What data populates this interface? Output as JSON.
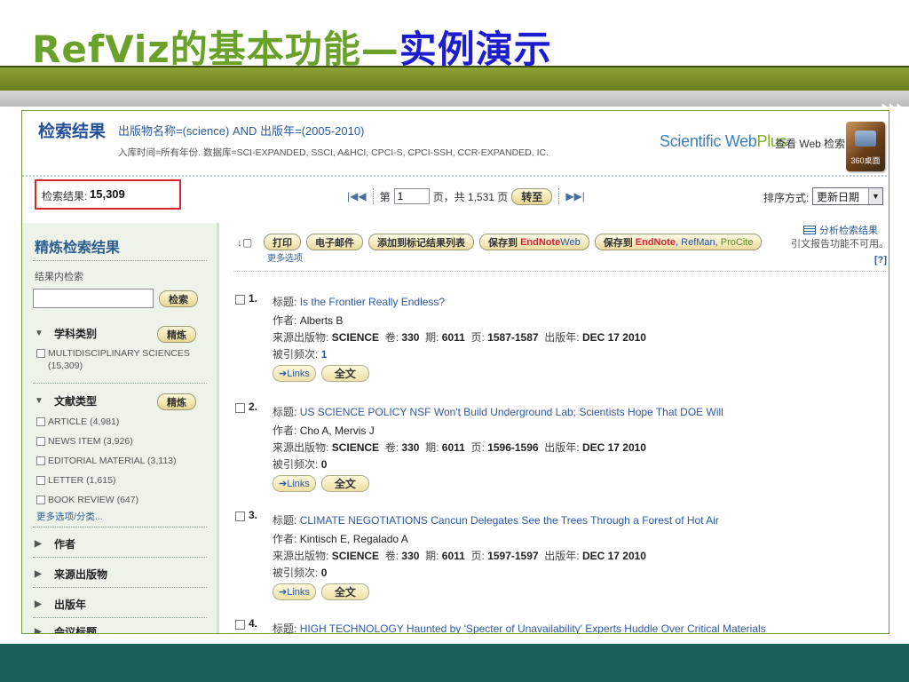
{
  "slide": {
    "title_green": "RefViz的基本功能",
    "title_sep": "—",
    "title_blue": "实例演示"
  },
  "colors": {
    "title_green": "#6aa12a",
    "title_blue": "#1d1dd0",
    "band_olive": "#7a9127",
    "band_teal": "#1a5f58",
    "highlight_red": "#d8262d"
  },
  "wos": {
    "title": "检索结果",
    "query_line1": "出版物名称=(science) AND 出版年=(2005-2010)",
    "query_line2": "入库时间=所有年份. 数据库=SCI-EXPANDED, SSCI, A&HCI, CPCI-S, CPCI-SSH, CCR-EXPANDED, IC.",
    "swp_logo_a": "Scientific Web",
    "swp_logo_b": "Plus",
    "swp_link": "查看 Web 检索",
    "search360_label": "360桌面",
    "count_label": "检索结果:",
    "count_value": "15,309",
    "pager": {
      "first": "|◀◀",
      "page_label": "第",
      "page_value": "1",
      "page_total": "页，共 1,531 页",
      "go": "转至",
      "next": "▶▶|"
    },
    "sort_label": "排序方式:",
    "sort_value": "更新日期"
  },
  "sidebar": {
    "title": "精炼检索结果",
    "sub_label": "结果内检索",
    "search_btn": "检索",
    "refine_btn": "精炼",
    "facets": [
      {
        "name": "学科类别",
        "items": [
          "MULTIDISCIPLINARY SCIENCES (15,309)"
        ]
      },
      {
        "name": "文献类型",
        "items": [
          "ARTICLE (4,981)",
          "NEWS ITEM (3,926)",
          "EDITORIAL MATERIAL (3,113)",
          "LETTER (1,615)",
          "BOOK REVIEW (647)"
        ]
      }
    ],
    "more_link": "更多选项/分类...",
    "collapsed": [
      "作者",
      "来源出版物",
      "出版年",
      "会议标题"
    ]
  },
  "toolbar": {
    "print": "打印",
    "email": "电子邮件",
    "add_marked": "添加到标记结果列表",
    "save_enweb_a": "保存到",
    "save_enweb_b": "EndNote",
    "save_enweb_c": "Web",
    "save_en_a": "保存到",
    "save_en_b": "EndNote",
    "save_en_c": ", RefMan,",
    "save_en_d": "ProCite",
    "more_options": "更多选项",
    "analyze": "分析检索结果",
    "cite_note": "引文报告功能不可用。",
    "help": "[?]"
  },
  "records": [
    {
      "num": "1.",
      "title": "Is the Frontier Really Endless?",
      "authors": "Alberts B",
      "journal": "SCIENCE",
      "volume": "330",
      "issue": "6011",
      "pages": "1587-1587",
      "date": "DEC 17 2010",
      "cited": "1"
    },
    {
      "num": "2.",
      "title": "US SCIENCE POLICY NSF Won't Build Underground Lab; Scientists Hope That DOE Will",
      "authors": "Cho A, Mervis J",
      "journal": "SCIENCE",
      "volume": "330",
      "issue": "6011",
      "pages": "1596-1596",
      "date": "DEC 17 2010",
      "cited": "0"
    },
    {
      "num": "3.",
      "title": "CLIMATE NEGOTIATIONS Cancun Delegates See the Trees Through a Forest of Hot Air",
      "authors": "Kintisch E, Regalado A",
      "journal": "SCIENCE",
      "volume": "330",
      "issue": "6011",
      "pages": "1597-1597",
      "date": "DEC 17 2010",
      "cited": "0"
    },
    {
      "num": "4.",
      "title": "HIGH TECHNOLOGY Haunted by 'Specter of Unavailability' Experts Huddle Over Critical Materials"
    }
  ],
  "rec_labels": {
    "title": "标题:",
    "author": "作者:",
    "source": "来源出版物:",
    "volume": "卷:",
    "issue": "期:",
    "pages": "页:",
    "date": "出版年:",
    "cited": "被引频次:",
    "links": "Links",
    "full": "全文"
  }
}
